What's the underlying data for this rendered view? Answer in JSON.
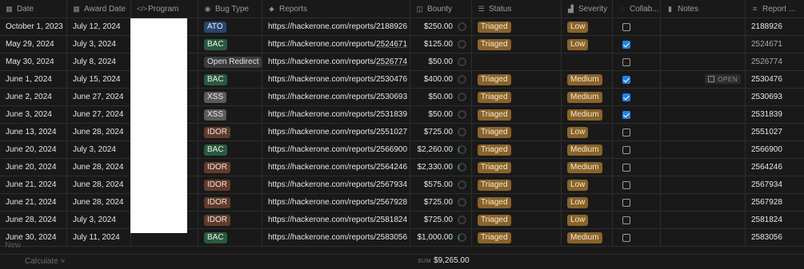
{
  "headers": {
    "date": "Date",
    "award_date": "Award Date",
    "program": "Program",
    "bug_type": "Bug Type",
    "reports": "Reports",
    "bounty": "Bounty",
    "status": "Status",
    "severity": "Severity",
    "collab": "Collab...",
    "notes": "Notes",
    "report_id": "Report ..."
  },
  "header_icons": {
    "date": "calendar-icon",
    "award_date": "calendar-icon",
    "program": "code-icon",
    "bug_type": "select-icon",
    "reports": "link-icon",
    "bounty": "money-icon",
    "status": "list-icon",
    "severity": "bars-icon",
    "collab": "checkbox-icon",
    "notes": "bookmark-icon",
    "report_id": "text-icon"
  },
  "rows": [
    {
      "date": "October 1, 2023",
      "award": "July 12, 2024",
      "bug": "ATO",
      "bug_color": "ato",
      "url_prefix": "https://hackerone.com/reports/",
      "url_id": "2188926",
      "bounty": "$250.00",
      "status": "Triaged",
      "severity": "Low",
      "collab": false,
      "notes": "",
      "rid": "2188926",
      "ring": false
    },
    {
      "date": "May 29, 2024",
      "award": "July 3, 2024",
      "bug": "BAC",
      "bug_color": "bac",
      "url_prefix": "https://hackerone.com/reports/",
      "url_id": "2524671",
      "bounty": "$125.00",
      "status": "Triaged",
      "severity": "Low",
      "collab": true,
      "notes": "",
      "rid": "2524671",
      "ring": false
    },
    {
      "date": "May 30, 2024",
      "award": "July 8, 2024",
      "bug": "Open Redirect",
      "bug_color": "open",
      "url_prefix": "https://hackerone.com/reports/",
      "url_id": "2526774",
      "bounty": "$50.00",
      "status": "",
      "severity": "",
      "collab": false,
      "notes": "",
      "rid": "2526774",
      "ring": false
    },
    {
      "date": "June 1, 2024",
      "award": "July 15, 2024",
      "bug": "BAC",
      "bug_color": "bac",
      "url_prefix": "https://hackerone.com/reports/",
      "url_id": "2530476",
      "bounty": "$400.00",
      "status": "Triaged",
      "severity": "Medium",
      "collab": true,
      "notes": "OPEN",
      "rid": "2530476",
      "ring": false
    },
    {
      "date": "June 2, 2024",
      "award": "June 27, 2024",
      "bug": "XSS",
      "bug_color": "xss",
      "url_prefix": "https://hackerone.com/reports/",
      "url_id": "2530693",
      "bounty": "$50.00",
      "status": "Triaged",
      "severity": "Medium",
      "collab": true,
      "notes": "",
      "rid": "2530693",
      "ring": false
    },
    {
      "date": "June 3, 2024",
      "award": "June 27, 2024",
      "bug": "XSS",
      "bug_color": "xss",
      "url_prefix": "https://hackerone.com/reports/",
      "url_id": "2531839",
      "bounty": "$50.00",
      "status": "Triaged",
      "severity": "Medium",
      "collab": true,
      "notes": "",
      "rid": "2531839",
      "ring": false
    },
    {
      "date": "June 13, 2024",
      "award": "June 28, 2024",
      "bug": "IDOR",
      "bug_color": "idor",
      "url_prefix": "https://hackerone.com/reports/",
      "url_id": "2551027",
      "bounty": "$725.00",
      "status": "Triaged",
      "severity": "Low",
      "collab": false,
      "notes": "",
      "rid": "2551027",
      "ring": false
    },
    {
      "date": "June 20, 2024",
      "award": "July 3, 2024",
      "bug": "BAC",
      "bug_color": "bac",
      "url_prefix": "https://hackerone.com/reports/",
      "url_id": "2566900",
      "bounty": "$2,260.00",
      "status": "Triaged",
      "severity": "Medium",
      "collab": false,
      "notes": "",
      "rid": "2566900",
      "ring": true
    },
    {
      "date": "June 20, 2024",
      "award": "June 28, 2024",
      "bug": "IDOR",
      "bug_color": "idor",
      "url_prefix": "https://hackerone.com/reports/",
      "url_id": "2564246",
      "bounty": "$2,330.00",
      "status": "Triaged",
      "severity": "Medium",
      "collab": false,
      "notes": "",
      "rid": "2564246",
      "ring": true
    },
    {
      "date": "June 21, 2024",
      "award": "June 28, 2024",
      "bug": "IDOR",
      "bug_color": "idor",
      "url_prefix": "https://hackerone.com/reports/",
      "url_id": "2567934",
      "bounty": "$575.00",
      "status": "Triaged",
      "severity": "Low",
      "collab": false,
      "notes": "",
      "rid": "2567934",
      "ring": false
    },
    {
      "date": "June 21, 2024",
      "award": "June 28, 2024",
      "bug": "IDOR",
      "bug_color": "idor",
      "url_prefix": "https://hackerone.com/reports/",
      "url_id": "2567928",
      "bounty": "$725.00",
      "status": "Triaged",
      "severity": "Low",
      "collab": false,
      "notes": "",
      "rid": "2567928",
      "ring": false
    },
    {
      "date": "June 28, 2024",
      "award": "July 3, 2024",
      "bug": "IDOR",
      "bug_color": "idor",
      "url_prefix": "https://hackerone.com/reports/",
      "url_id": "2581824",
      "bounty": "$725.00",
      "status": "Triaged",
      "severity": "Low",
      "collab": false,
      "notes": "",
      "rid": "2581824",
      "ring": false
    },
    {
      "date": "June 30, 2024",
      "award": "July 11, 2024",
      "bug": "BAC",
      "bug_color": "bac",
      "url_prefix": "https://hackerone.com/reports/",
      "url_id": "2583056",
      "bounty": "$1,000.00",
      "status": "Triaged",
      "severity": "Medium",
      "collab": false,
      "notes": "",
      "rid": "2583056",
      "ring": true
    }
  ],
  "footer": {
    "new_label": "New",
    "calculate_label": "Calculate ˅",
    "sum_label": "SUM",
    "sum_value": "$9,265.00"
  }
}
